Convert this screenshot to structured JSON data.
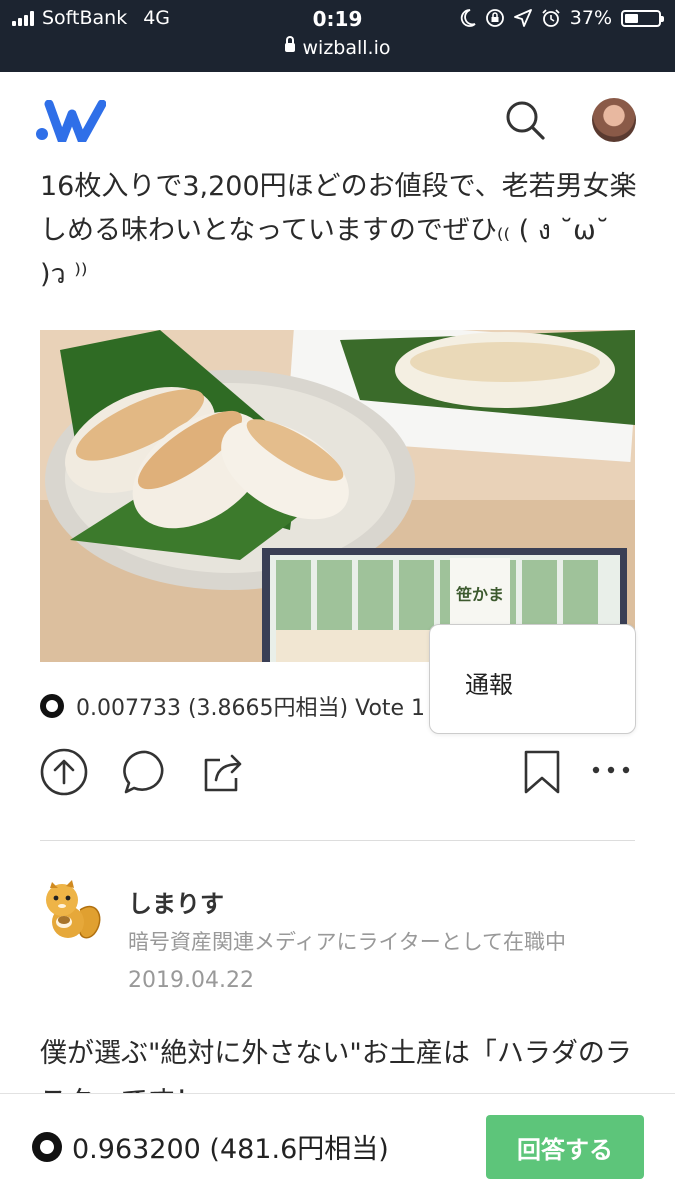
{
  "status_bar": {
    "carrier": "SoftBank",
    "network": "4G",
    "time": "0:19",
    "battery": "37%",
    "url": "wizball.io"
  },
  "post": {
    "text": "16枚入りで3,200円ほどのお値段で、老若男女楽しめる味わいとなっていますのでぜひ₍₍ ( ง ˘ω˘ )ว ⁾⁾",
    "reward_line": "0.007733 (3.8665円相当) Vote 1",
    "image_package_label": "笹かま"
  },
  "popup_menu": {
    "report_label": "通報"
  },
  "actions": {
    "icons": [
      "upvote-icon",
      "comment-icon",
      "share-icon",
      "bookmark-icon",
      "more-icon"
    ]
  },
  "answer": {
    "author_name": "しまりす",
    "author_description": "暗号資産関連メディアにライターとして在職中",
    "date": "2019.04.22",
    "text": "僕が選ぶ\"絶対に外さない\"お土産は「ハラダのラスク」です！"
  },
  "bottom_bar": {
    "amount": "0.963200 (481.6円相当)",
    "answer_button_label": "回答する"
  },
  "colors": {
    "status_bar_bg": "#1c2430",
    "logo_blue": "#2f6fe8",
    "answer_button": "#5dc57a"
  }
}
